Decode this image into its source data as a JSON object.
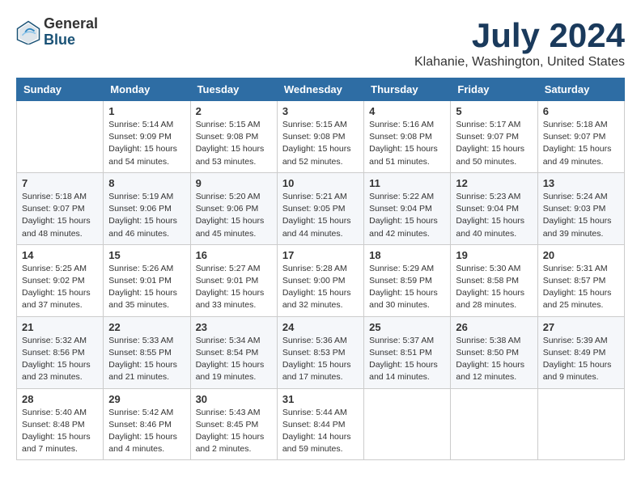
{
  "logo": {
    "general": "General",
    "blue": "Blue"
  },
  "title": "July 2024",
  "location": "Klahanie, Washington, United States",
  "days_of_week": [
    "Sunday",
    "Monday",
    "Tuesday",
    "Wednesday",
    "Thursday",
    "Friday",
    "Saturday"
  ],
  "weeks": [
    [
      {
        "day": "",
        "info": ""
      },
      {
        "day": "1",
        "info": "Sunrise: 5:14 AM\nSunset: 9:09 PM\nDaylight: 15 hours\nand 54 minutes."
      },
      {
        "day": "2",
        "info": "Sunrise: 5:15 AM\nSunset: 9:08 PM\nDaylight: 15 hours\nand 53 minutes."
      },
      {
        "day": "3",
        "info": "Sunrise: 5:15 AM\nSunset: 9:08 PM\nDaylight: 15 hours\nand 52 minutes."
      },
      {
        "day": "4",
        "info": "Sunrise: 5:16 AM\nSunset: 9:08 PM\nDaylight: 15 hours\nand 51 minutes."
      },
      {
        "day": "5",
        "info": "Sunrise: 5:17 AM\nSunset: 9:07 PM\nDaylight: 15 hours\nand 50 minutes."
      },
      {
        "day": "6",
        "info": "Sunrise: 5:18 AM\nSunset: 9:07 PM\nDaylight: 15 hours\nand 49 minutes."
      }
    ],
    [
      {
        "day": "7",
        "info": "Sunrise: 5:18 AM\nSunset: 9:07 PM\nDaylight: 15 hours\nand 48 minutes."
      },
      {
        "day": "8",
        "info": "Sunrise: 5:19 AM\nSunset: 9:06 PM\nDaylight: 15 hours\nand 46 minutes."
      },
      {
        "day": "9",
        "info": "Sunrise: 5:20 AM\nSunset: 9:06 PM\nDaylight: 15 hours\nand 45 minutes."
      },
      {
        "day": "10",
        "info": "Sunrise: 5:21 AM\nSunset: 9:05 PM\nDaylight: 15 hours\nand 44 minutes."
      },
      {
        "day": "11",
        "info": "Sunrise: 5:22 AM\nSunset: 9:04 PM\nDaylight: 15 hours\nand 42 minutes."
      },
      {
        "day": "12",
        "info": "Sunrise: 5:23 AM\nSunset: 9:04 PM\nDaylight: 15 hours\nand 40 minutes."
      },
      {
        "day": "13",
        "info": "Sunrise: 5:24 AM\nSunset: 9:03 PM\nDaylight: 15 hours\nand 39 minutes."
      }
    ],
    [
      {
        "day": "14",
        "info": "Sunrise: 5:25 AM\nSunset: 9:02 PM\nDaylight: 15 hours\nand 37 minutes."
      },
      {
        "day": "15",
        "info": "Sunrise: 5:26 AM\nSunset: 9:01 PM\nDaylight: 15 hours\nand 35 minutes."
      },
      {
        "day": "16",
        "info": "Sunrise: 5:27 AM\nSunset: 9:01 PM\nDaylight: 15 hours\nand 33 minutes."
      },
      {
        "day": "17",
        "info": "Sunrise: 5:28 AM\nSunset: 9:00 PM\nDaylight: 15 hours\nand 32 minutes."
      },
      {
        "day": "18",
        "info": "Sunrise: 5:29 AM\nSunset: 8:59 PM\nDaylight: 15 hours\nand 30 minutes."
      },
      {
        "day": "19",
        "info": "Sunrise: 5:30 AM\nSunset: 8:58 PM\nDaylight: 15 hours\nand 28 minutes."
      },
      {
        "day": "20",
        "info": "Sunrise: 5:31 AM\nSunset: 8:57 PM\nDaylight: 15 hours\nand 25 minutes."
      }
    ],
    [
      {
        "day": "21",
        "info": "Sunrise: 5:32 AM\nSunset: 8:56 PM\nDaylight: 15 hours\nand 23 minutes."
      },
      {
        "day": "22",
        "info": "Sunrise: 5:33 AM\nSunset: 8:55 PM\nDaylight: 15 hours\nand 21 minutes."
      },
      {
        "day": "23",
        "info": "Sunrise: 5:34 AM\nSunset: 8:54 PM\nDaylight: 15 hours\nand 19 minutes."
      },
      {
        "day": "24",
        "info": "Sunrise: 5:36 AM\nSunset: 8:53 PM\nDaylight: 15 hours\nand 17 minutes."
      },
      {
        "day": "25",
        "info": "Sunrise: 5:37 AM\nSunset: 8:51 PM\nDaylight: 15 hours\nand 14 minutes."
      },
      {
        "day": "26",
        "info": "Sunrise: 5:38 AM\nSunset: 8:50 PM\nDaylight: 15 hours\nand 12 minutes."
      },
      {
        "day": "27",
        "info": "Sunrise: 5:39 AM\nSunset: 8:49 PM\nDaylight: 15 hours\nand 9 minutes."
      }
    ],
    [
      {
        "day": "28",
        "info": "Sunrise: 5:40 AM\nSunset: 8:48 PM\nDaylight: 15 hours\nand 7 minutes."
      },
      {
        "day": "29",
        "info": "Sunrise: 5:42 AM\nSunset: 8:46 PM\nDaylight: 15 hours\nand 4 minutes."
      },
      {
        "day": "30",
        "info": "Sunrise: 5:43 AM\nSunset: 8:45 PM\nDaylight: 15 hours\nand 2 minutes."
      },
      {
        "day": "31",
        "info": "Sunrise: 5:44 AM\nSunset: 8:44 PM\nDaylight: 14 hours\nand 59 minutes."
      },
      {
        "day": "",
        "info": ""
      },
      {
        "day": "",
        "info": ""
      },
      {
        "day": "",
        "info": ""
      }
    ]
  ]
}
